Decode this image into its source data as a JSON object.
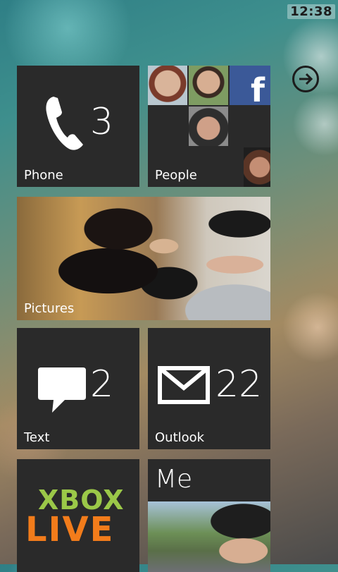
{
  "status": {
    "time": "12:38"
  },
  "tiles": {
    "phone": {
      "label": "Phone",
      "count": "3"
    },
    "people": {
      "label": "People",
      "facebook_glyph": "f"
    },
    "pictures": {
      "label": "Pictures"
    },
    "text": {
      "label": "Text",
      "count": "2"
    },
    "outlook": {
      "label": "Outlook",
      "count": "22"
    },
    "xbox": {
      "logo_top": "XBOX",
      "logo_bottom": "LIVE"
    },
    "me": {
      "title": "Me"
    }
  },
  "icons": {
    "phone": "phone-handset-icon",
    "text": "speech-bubble-icon",
    "outlook": "envelope-icon",
    "app_list": "arrow-right-circle-icon"
  },
  "colors": {
    "tile_background": "#2a2a2a",
    "facebook": "#3b5998",
    "xbox_green": "#9bc848",
    "live_orange": "#f27c1b"
  }
}
